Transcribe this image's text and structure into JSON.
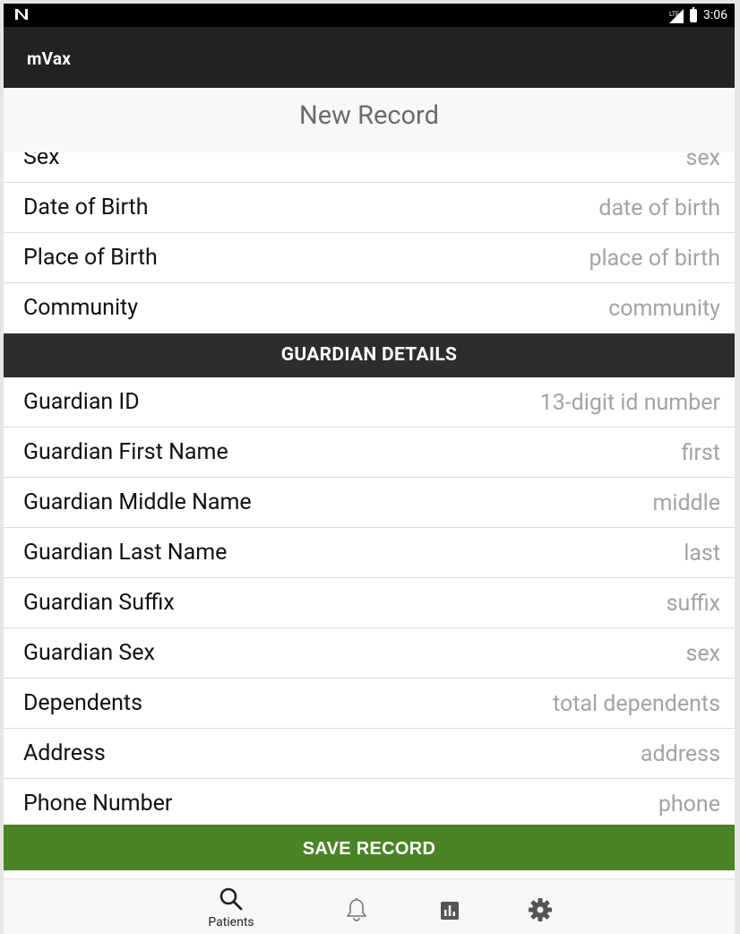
{
  "status_bar": {
    "network": "LTE",
    "time": "3:06"
  },
  "app": {
    "title": "mVax"
  },
  "form": {
    "title": "New Record",
    "rows_top": [
      {
        "label": "Sex",
        "placeholder": "sex"
      },
      {
        "label": "Date of Birth",
        "placeholder": "date of birth"
      },
      {
        "label": "Place of Birth",
        "placeholder": "place of birth"
      },
      {
        "label": "Community",
        "placeholder": "community"
      }
    ],
    "guardian_section_title": "GUARDIAN DETAILS",
    "rows_guardian": [
      {
        "label": "Guardian ID",
        "placeholder": "13-digit id number"
      },
      {
        "label": "Guardian First Name",
        "placeholder": "first"
      },
      {
        "label": "Guardian Middle Name",
        "placeholder": "middle"
      },
      {
        "label": "Guardian Last Name",
        "placeholder": "last"
      },
      {
        "label": "Guardian Suffix",
        "placeholder": "suffix"
      },
      {
        "label": "Guardian Sex",
        "placeholder": "sex"
      },
      {
        "label": "Dependents",
        "placeholder": "total dependents"
      },
      {
        "label": "Address",
        "placeholder": "address"
      },
      {
        "label": "Phone Number",
        "placeholder": "phone"
      }
    ],
    "save_label": "SAVE RECORD"
  },
  "tabs": [
    {
      "label": "Patients",
      "icon": "search-icon"
    },
    {
      "label": "",
      "icon": "bell-icon"
    },
    {
      "label": "",
      "icon": "bar-chart-icon"
    },
    {
      "label": "",
      "icon": "gear-icon"
    }
  ],
  "colors": {
    "app_bar": "#222222",
    "section_header": "#2d2d2d",
    "save_button": "#4a8427"
  }
}
